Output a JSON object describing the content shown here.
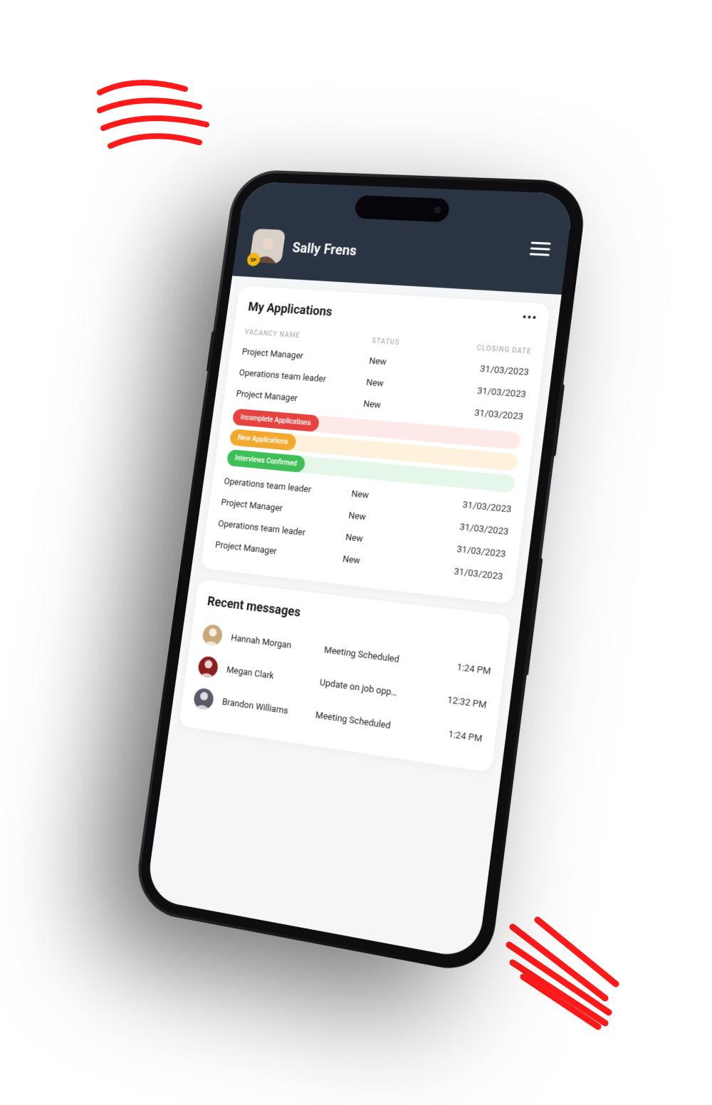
{
  "user": {
    "name": "Sally Frens",
    "initials": "SF"
  },
  "applications": {
    "title": "My Applications",
    "columns": {
      "vacancy": "VACANCY NAME",
      "status": "STATUS",
      "closing": "CLOSING DATE"
    },
    "rows_top": [
      {
        "vacancy": "Project Manager",
        "status": "New",
        "closing": "31/03/2023"
      },
      {
        "vacancy": "Operations team leader",
        "status": "New",
        "closing": "31/03/2023"
      },
      {
        "vacancy": "Project Manager",
        "status": "New",
        "closing": "31/03/2023"
      }
    ],
    "pills": [
      {
        "label": "Incomplete Applications",
        "color": "#e6423f",
        "track": "#fde9e8"
      },
      {
        "label": "New Applications",
        "color": "#f1a92e",
        "track": "#fef2dc"
      },
      {
        "label": "Interviews Confirmed",
        "color": "#3fbf57",
        "track": "#e4f7e8"
      }
    ],
    "rows_bottom": [
      {
        "vacancy": "Operations team leader",
        "status": "New",
        "closing": "31/03/2023"
      },
      {
        "vacancy": "Project Manager",
        "status": "New",
        "closing": "31/03/2023"
      },
      {
        "vacancy": "Operations team leader",
        "status": "New",
        "closing": "31/03/2023"
      },
      {
        "vacancy": "Project Manager",
        "status": "New",
        "closing": "31/03/2023"
      }
    ]
  },
  "messages": {
    "title": "Recent messages",
    "items": [
      {
        "name": "Hannah Morgan",
        "subject": "Meeting Scheduled",
        "time": "1:24 PM",
        "avatar_bg": "#c9a97a"
      },
      {
        "name": "Megan Clark",
        "subject": "Update on job opp…",
        "time": "12:32 PM",
        "avatar_bg": "#8b1e1e"
      },
      {
        "name": "Brandon Williams",
        "subject": "Meeting Scheduled",
        "time": "1:24 PM",
        "avatar_bg": "#5a5a6a"
      }
    ]
  }
}
